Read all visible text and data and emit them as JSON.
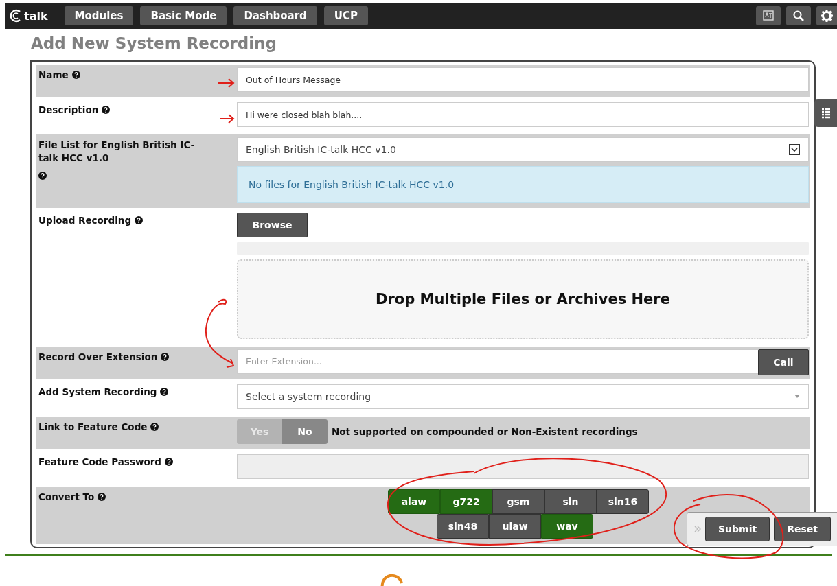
{
  "topbar": {
    "logo_text": "talk",
    "nav": [
      {
        "label": "Modules"
      },
      {
        "label": "Basic Mode"
      },
      {
        "label": "Dashboard"
      },
      {
        "label": "UCP"
      }
    ]
  },
  "title": "Add New System Recording",
  "rows": [
    {
      "kind": "text",
      "label": "Name",
      "value": "Out of Hours Message"
    },
    {
      "kind": "text",
      "label": "Description",
      "value": "Hi were closed blah blah...."
    },
    {
      "kind": "filelist",
      "label": "File List for English British IC-talk HCC v1.0",
      "value": "English British IC-talk HCC v1.0",
      "note": "No files for English British IC-talk HCC v1.0"
    },
    {
      "kind": "upload",
      "label": "Upload Recording",
      "button": "Browse",
      "dropzone": "Drop Multiple Files or Archives Here"
    },
    {
      "kind": "call",
      "label": "Record Over Extension",
      "placeholder": "Enter Extension...",
      "button": "Call"
    },
    {
      "kind": "select",
      "label": "Add System Recording",
      "value": "Select a system recording"
    },
    {
      "kind": "toggle",
      "label": "Link to Feature Code",
      "options": [
        {
          "label": "Yes",
          "selected": false
        },
        {
          "label": "No",
          "selected": true
        }
      ],
      "note": "Not supported on compounded or Non-Existent recordings"
    },
    {
      "kind": "password",
      "label": "Feature Code Password"
    },
    {
      "kind": "formats",
      "label": "Convert To",
      "formats": [
        {
          "label": "alaw",
          "selected": true
        },
        {
          "label": "g722",
          "selected": true
        },
        {
          "label": "gsm",
          "selected": false
        },
        {
          "label": "sln",
          "selected": false
        },
        {
          "label": "sln16",
          "selected": false
        },
        {
          "label": "sln48",
          "selected": false
        },
        {
          "label": "ulaw",
          "selected": false
        },
        {
          "label": "wav",
          "selected": true
        }
      ]
    }
  ],
  "actions": {
    "buttons": [
      "Submit",
      "Reset"
    ]
  }
}
